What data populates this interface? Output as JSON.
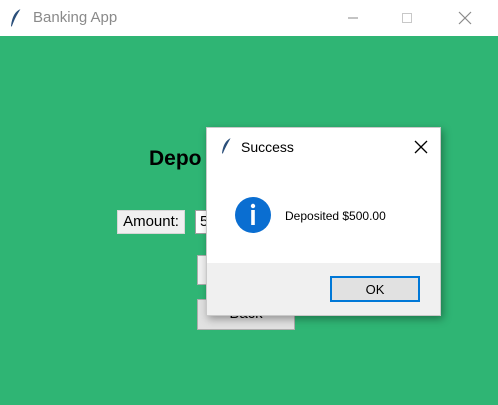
{
  "window": {
    "title": "Banking App"
  },
  "main": {
    "heading": "Depo",
    "amount_label": "Amount:",
    "amount_value": "5",
    "back_button": "Back"
  },
  "dialog": {
    "title": "Success",
    "message": "Deposited $500.00",
    "ok_label": "OK"
  },
  "icons": {
    "app": "feather-icon",
    "dialog_type": "info-icon"
  },
  "colors": {
    "background": "#2fb574",
    "accent": "#0078d7",
    "info_icon": "#0a6ed1"
  }
}
